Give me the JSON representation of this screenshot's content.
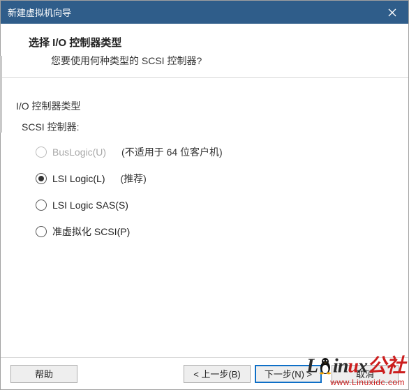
{
  "titlebar": {
    "title": "新建虚拟机向导"
  },
  "header": {
    "title": "选择 I/O 控制器类型",
    "subtitle": "您要使用何种类型的 SCSI 控制器?"
  },
  "section": {
    "label": "I/O 控制器类型",
    "group": "SCSI 控制器:"
  },
  "options": {
    "buslogic": {
      "label": "BusLogic(U)",
      "hint": "(不适用于 64 位客户机)"
    },
    "lsilogic": {
      "label": "LSI Logic(L)",
      "hint": "(推荐)"
    },
    "lsisas": {
      "label": "LSI Logic SAS(S)"
    },
    "pvscsi": {
      "label": "准虚拟化 SCSI(P)"
    }
  },
  "buttons": {
    "help": "帮助",
    "back": "< 上一步(B)",
    "next": "下一步(N) >",
    "cancel": "取消"
  },
  "watermark": {
    "logo_prefix": "L",
    "logo_mid": "in",
    "logo_u": "u",
    "logo_suffix_x": "x",
    "logo_suffix": "公社",
    "url": "www.Linuxidc.com"
  }
}
